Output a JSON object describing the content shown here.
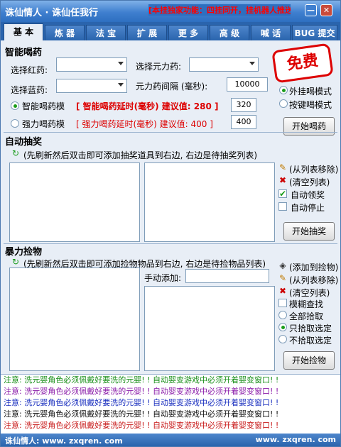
{
  "window": {
    "title": "诛仙情人 · 诛仙任我行",
    "marquee": "[本挂独家功能：四挂同开，挂机器人推送！!]"
  },
  "tabs": [
    "基 本",
    "炼 器",
    "法 宝",
    "扩 展",
    "更 多",
    "高 级",
    "喊 话",
    "BUG 提交"
  ],
  "smart_potion": {
    "section_title": "智能喝药",
    "red_label": "选择红药:",
    "blue_label": "选择蓝药:",
    "yuanli_label": "选择元力药:",
    "yuanli_interval_label": "元力药间隔 (毫秒):",
    "yuanli_interval_value": "10000",
    "smart_mode_label": "智能喝药模",
    "smart_mode_hint": "[ 智能喝药延时(毫秒) 建议值: 280 ]",
    "smart_mode_value": "320",
    "force_mode_label": "强力喝药模",
    "force_mode_hint": "[ 强力喝药延时(毫秒) 建议值: 400 ]",
    "force_mode_value": "400",
    "ext_mode_label": "外挂喝模式",
    "key_mode_label": "按键喝模式",
    "start_button": "开始喝药",
    "free_badge": "免费"
  },
  "auto_lottery": {
    "section_title": "自动抽奖",
    "hint": "(先刷新然后双击即可添加抽奖道具到右边, 右边是待抽奖列表)",
    "remove_label": "(从列表移除)",
    "clear_label": "(清空列表)",
    "auto_claim_label": "自动领奖",
    "auto_stop_label": "自动停止",
    "start_button": "开始抽奖"
  },
  "force_pickup": {
    "section_title": "暴力捡物",
    "hint": "(先刷新然后双击即可添加捡物物品到右边, 右边是待捡物品列表)",
    "manual_add_label": "手动添加:",
    "add_label": "(添加到捡物)",
    "remove_label": "(从列表移除)",
    "clear_label": "(清空列表)",
    "fuzzy_label": "模糊查找",
    "all_label": "全部拾取",
    "selected_label": "只拾取选定",
    "not_selected_label": "不拾取选定",
    "start_button": "开始捡物"
  },
  "notes": [
    {
      "text": "注意: 洗元婴角色必须佩戴好要洗的元婴! ! 自动婴变游戏中必须开着婴变窗口! !",
      "color": "#1a8f1a"
    },
    {
      "text": "注意: 洗元婴角色必须佩戴好要洗的元婴! ! 自动婴变游戏中必须开着婴变窗口! !",
      "color": "#8a1aa8"
    },
    {
      "text": "注意: 洗元婴角色必须佩戴好要洗的元婴! ! 自动婴变游戏中必须开着婴变窗口! !",
      "color": "#1a2fbf"
    },
    {
      "text": "注意: 洗元婴角色必须佩戴好要洗的元婴! ! 自动婴变游戏中必须开着婴变窗口! !",
      "color": "#111111"
    },
    {
      "text": "注意: 洗元婴角色必须佩戴好要洗的元婴! ! 自动婴变游戏中必须开着婴变窗口! !",
      "color": "#c81a1a"
    }
  ],
  "status": {
    "left": "诛仙情人: www. zxqren. com",
    "right": "www. zxqren. com"
  }
}
